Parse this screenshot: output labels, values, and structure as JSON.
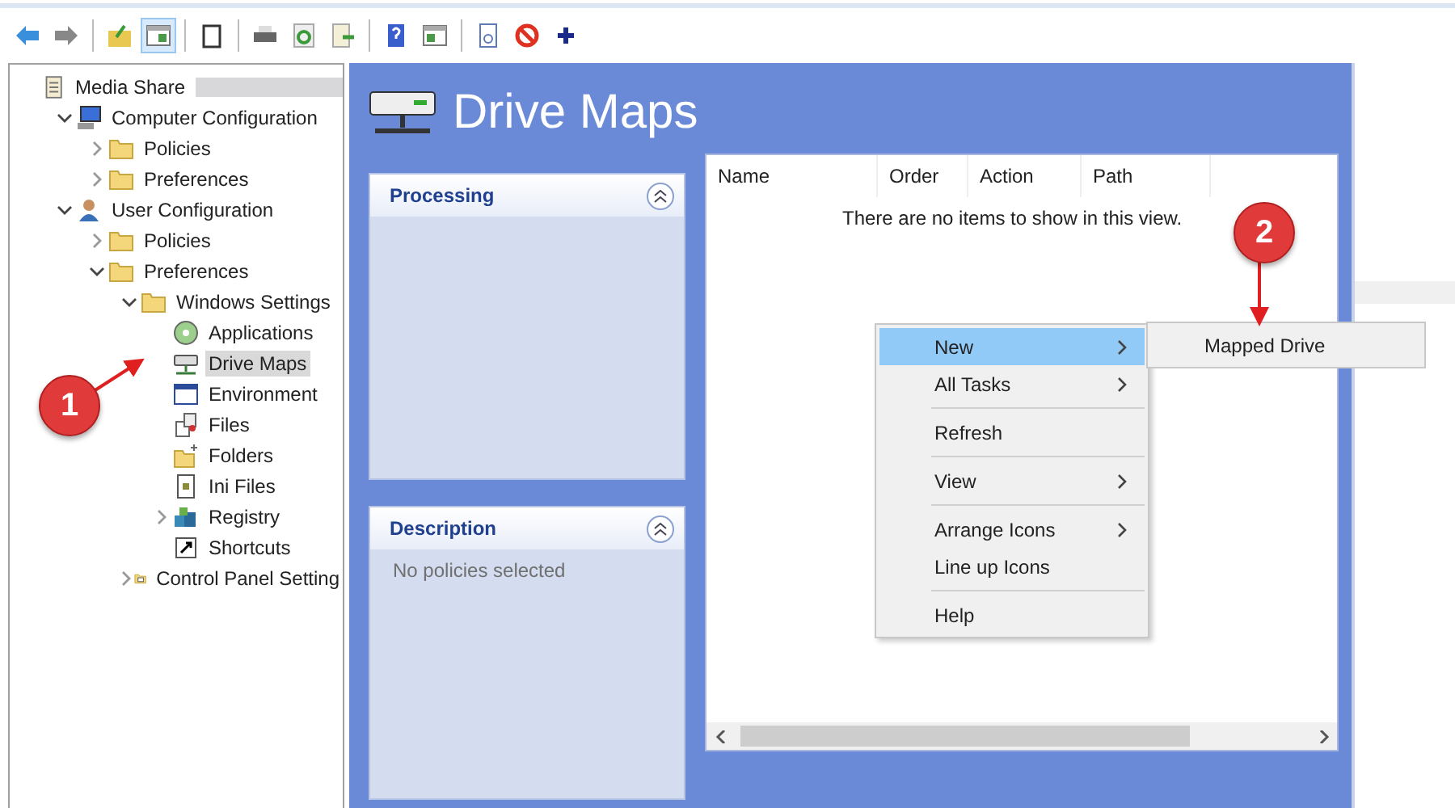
{
  "toolbar": {
    "buttons": [
      {
        "kind": "back",
        "pressed": false
      },
      {
        "kind": "forward",
        "pressed": false
      },
      {
        "kind": "sep"
      },
      {
        "kind": "up",
        "pressed": false
      },
      {
        "kind": "tree",
        "pressed": true
      },
      {
        "kind": "sep"
      },
      {
        "kind": "clipboard",
        "pressed": false
      },
      {
        "kind": "sep"
      },
      {
        "kind": "print",
        "pressed": false
      },
      {
        "kind": "refresh",
        "pressed": false
      },
      {
        "kind": "export",
        "pressed": false
      },
      {
        "kind": "sep"
      },
      {
        "kind": "help",
        "pressed": false
      },
      {
        "kind": "panel",
        "pressed": false
      },
      {
        "kind": "sep"
      },
      {
        "kind": "page",
        "pressed": false
      },
      {
        "kind": "stop",
        "pressed": false
      },
      {
        "kind": "plus",
        "pressed": false
      }
    ]
  },
  "tree": {
    "root": {
      "label": "Media Share",
      "kind": "doc",
      "redacted": true,
      "selected": false,
      "children": [
        {
          "label": "Computer Configuration",
          "kind": "computer",
          "expanded": true,
          "selected": false,
          "children": [
            {
              "label": "Policies",
              "kind": "folder",
              "expanded": false,
              "selected": false
            },
            {
              "label": "Preferences",
              "kind": "folder",
              "expanded": false,
              "selected": false
            }
          ]
        },
        {
          "label": "User Configuration",
          "kind": "user",
          "expanded": true,
          "selected": false,
          "children": [
            {
              "label": "Policies",
              "kind": "folder",
              "expanded": false,
              "selected": false
            },
            {
              "label": "Preferences",
              "kind": "folder",
              "expanded": true,
              "selected": false,
              "children": [
                {
                  "label": "Windows Settings",
                  "kind": "folder",
                  "expanded": true,
                  "selected": false,
                  "children": [
                    {
                      "label": "Applications",
                      "kind": "disc",
                      "selected": false
                    },
                    {
                      "label": "Drive Maps",
                      "kind": "drive",
                      "selected": true
                    },
                    {
                      "label": "Environment",
                      "kind": "env",
                      "selected": false
                    },
                    {
                      "label": "Files",
                      "kind": "files",
                      "selected": false
                    },
                    {
                      "label": "Folders",
                      "kind": "folderstar",
                      "selected": false
                    },
                    {
                      "label": "Ini Files",
                      "kind": "ini",
                      "selected": false
                    },
                    {
                      "label": "Registry",
                      "kind": "registry",
                      "expanded": false,
                      "selected": false
                    },
                    {
                      "label": "Shortcuts",
                      "kind": "shortcut",
                      "selected": false
                    }
                  ]
                },
                {
                  "label": "Control Panel Setting",
                  "kind": "cpanel",
                  "expanded": false,
                  "selected": false
                }
              ]
            }
          ]
        }
      ]
    }
  },
  "content": {
    "title": "Drive Maps",
    "panels": [
      {
        "title": "Processing"
      },
      {
        "title": "Description",
        "text": "No policies selected"
      }
    ],
    "list": {
      "columns": [
        "Name",
        "Order",
        "Action",
        "Path"
      ],
      "empty_text": "There are no items to show in this view."
    }
  },
  "context_menu": {
    "groups": [
      [
        {
          "label": "New",
          "submenu": true,
          "selected": true
        },
        {
          "label": "All Tasks",
          "submenu": true,
          "selected": false
        }
      ],
      [
        {
          "label": "Refresh",
          "submenu": false,
          "selected": false
        }
      ],
      [
        {
          "label": "View",
          "submenu": true,
          "selected": false
        }
      ],
      [
        {
          "label": "Arrange Icons",
          "submenu": true,
          "selected": false
        },
        {
          "label": "Line up Icons",
          "submenu": false,
          "selected": false
        }
      ],
      [
        {
          "label": "Help",
          "submenu": false,
          "selected": false
        }
      ]
    ],
    "submenu": [
      {
        "label": "Mapped Drive"
      }
    ]
  },
  "annotations": [
    {
      "number": "1"
    },
    {
      "number": "2"
    }
  ]
}
